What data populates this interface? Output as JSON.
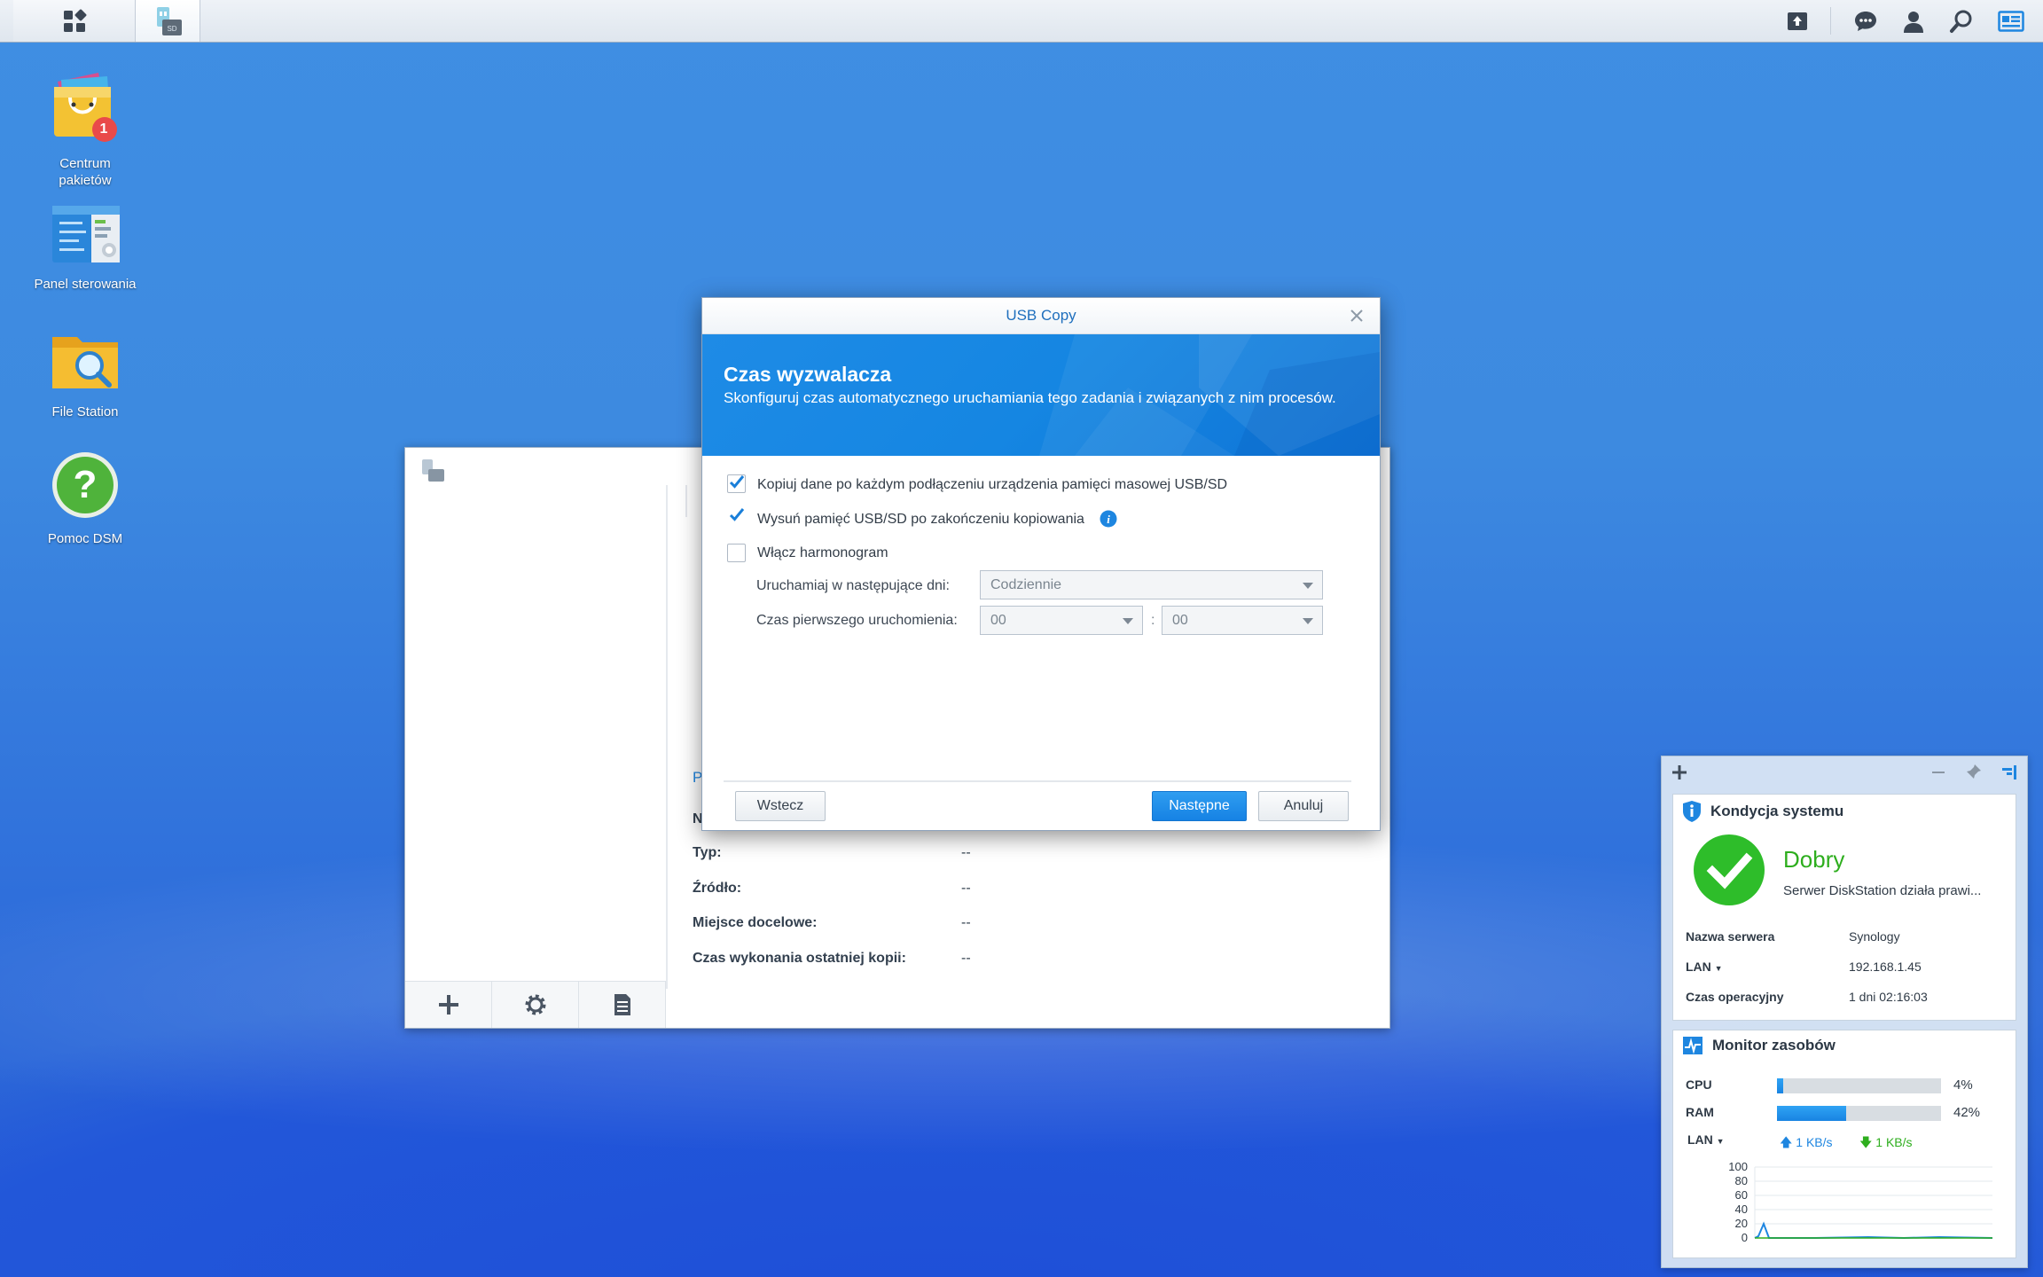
{
  "taskbar": {
    "main_menu_icon": "grid-icon",
    "open_app_icon": "usb-copy-icon",
    "right_icons": [
      "upload-queue-icon",
      "notifications-icon",
      "user-icon",
      "search-icon",
      "widgets-icon"
    ]
  },
  "desktop": {
    "icons": [
      {
        "label": "Centrum\npakietów",
        "badge": "1"
      },
      {
        "label": "Panel sterowania"
      },
      {
        "label": "File Station"
      },
      {
        "label": "Pomoc DSM"
      }
    ]
  },
  "bg_window": {
    "section_prefix": "P",
    "name_prefix": "N",
    "rows": [
      {
        "key": "Typ:",
        "value": "--"
      },
      {
        "key": "Źródło:",
        "value": "--"
      },
      {
        "key": "Miejsce docelowe:",
        "value": "--"
      },
      {
        "key": "Czas wykonania ostatniej kopii:",
        "value": "--"
      }
    ]
  },
  "dialog": {
    "title": "USB Copy",
    "heading": "Czas wyzwalacza",
    "subheading": "Skonfiguruj czas automatycznego uruchamiania tego zadania i związanych z nim procesów.",
    "options": [
      {
        "label": "Kopiuj dane po każdym podłączeniu urządzenia pamięci masowej USB/SD",
        "checked": true
      },
      {
        "label": "Wysuń pamięć USB/SD po zakończeniu kopiowania",
        "checked": true
      },
      {
        "label": "Włącz harmonogram",
        "checked": false
      }
    ],
    "days_label": "Uruchamiaj w następujące dni:",
    "days_value": "Codziennie",
    "first_run_label": "Czas pierwszego uruchomienia:",
    "hour_value": "00",
    "time_separator": ":",
    "minute_value": "00",
    "buttons": {
      "back": "Wstecz",
      "next": "Następne",
      "cancel": "Anuluj"
    }
  },
  "widgets": {
    "health": {
      "title": "Kondycja systemu",
      "status": "Dobry",
      "status_color": "#2eae1e",
      "message": "Serwer DiskStation działa prawi...",
      "rows": [
        {
          "key": "Nazwa serwera",
          "value": "Synology"
        },
        {
          "key": "LAN",
          "value": "192.168.1.45"
        },
        {
          "key": "Czas operacyjny",
          "value": "1 dni 02:16:03"
        }
      ]
    },
    "resource": {
      "title": "Monitor zasobów",
      "cpu_label": "CPU",
      "cpu_value": "4%",
      "cpu_fraction": 0.04,
      "ram_label": "RAM",
      "ram_value": "42%",
      "ram_fraction": 0.42,
      "lan_label": "LAN",
      "upload": "1 KB/s",
      "download": "1 KB/s",
      "chart_ticks": [
        "100",
        "80",
        "60",
        "40",
        "20",
        "0"
      ]
    }
  }
}
